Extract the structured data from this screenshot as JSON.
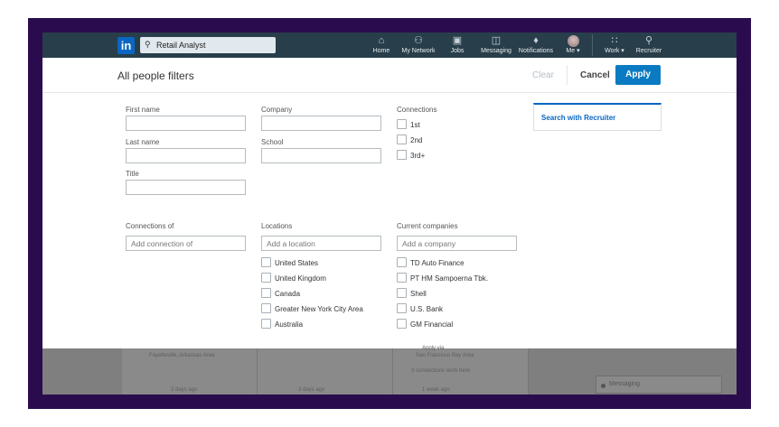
{
  "nav": {
    "search_value": "Retail Analyst",
    "items": [
      {
        "label": "Home",
        "icon": "home-icon"
      },
      {
        "label": "My Network",
        "icon": "network-icon"
      },
      {
        "label": "Jobs",
        "icon": "briefcase-icon"
      },
      {
        "label": "Messaging",
        "icon": "chat-icon"
      },
      {
        "label": "Notifications",
        "icon": "bell-icon"
      },
      {
        "label": "Me ▾",
        "icon": "avatar"
      },
      {
        "label": "Work ▾",
        "icon": "grid-icon"
      },
      {
        "label": "Recruiter",
        "icon": "recruiter-icon"
      }
    ]
  },
  "panel": {
    "title": "All people filters",
    "clear": "Clear",
    "cancel": "Cancel",
    "apply": "Apply",
    "recruiter_link": "Search with Recruiter",
    "labels": {
      "first_name": "First name",
      "last_name": "Last name",
      "title": "Title",
      "company": "Company",
      "school": "School",
      "connections": "Connections",
      "connections_of": "Connections of",
      "locations": "Locations",
      "current_companies": "Current companies"
    },
    "placeholders": {
      "connections_of": "Add connection of",
      "locations": "Add a location",
      "current_companies": "Add a company"
    },
    "connection_options": [
      "1st",
      "2nd",
      "3rd+"
    ],
    "location_options": [
      "United States",
      "United Kingdom",
      "Canada",
      "Greater New York City Area",
      "Australia"
    ],
    "company_options": [
      "TD Auto Finance",
      "PT HM Sampoerna Tbk.",
      "Shell",
      "U.S. Bank",
      "GM Financial"
    ]
  },
  "background": {
    "texts": [
      "Fayetteville, Arkansas Area",
      "San Francisco Bay Area",
      "3 connections work here",
      "Apply via",
      "3 days ago",
      "3 days ago",
      "1 week ago"
    ],
    "messaging": "Messaging"
  },
  "colors": {
    "accent": "#0a7bc2",
    "nav": "#283e4a",
    "frame": "#2a0c4e"
  }
}
